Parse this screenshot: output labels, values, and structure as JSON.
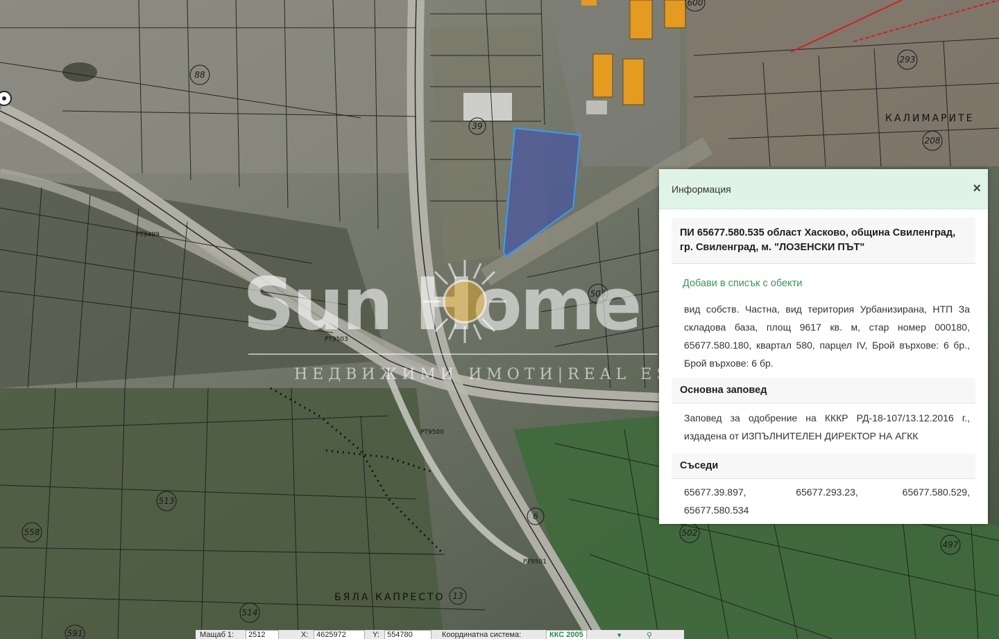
{
  "map": {
    "parcel_labels": [
      "88",
      "39",
      "293",
      "208",
      "503",
      "513",
      "558",
      "514",
      "502",
      "497",
      "591",
      "600",
      "13",
      "6"
    ],
    "place_labels": [
      "КАЛИМАРИТЕ",
      "БЯЛА КАПРЕСТО"
    ],
    "point_labels": [
      "PT9499",
      "PT9503",
      "PT9500",
      "PT9501"
    ],
    "selected_parcel_color": "#3a4ab3",
    "watermark": {
      "brand": "Sun Home",
      "tagline": "НЕДВИЖИМИ ИМОТИ|REAL ESTATE"
    }
  },
  "panel": {
    "title": "Информация",
    "close_glyph": "×",
    "pi_title": "ПИ 65677.580.535 област Хасково, община Свиленград, гр. Свиленград, м. \"ЛОЗЕНСКИ ПЪТ\"",
    "add_link": "Добави в списък с обекти",
    "details": "вид собств. Частна, вид територия Урбанизирана, НТП За складова база, площ 9617 кв. м, стар номер 000180, 65677.580.180, квартал 580, парцел IV, Брой върхове: 6 бр., Брой върхове: 6 бр.",
    "order_heading": "Основна заповед",
    "order_text": "Заповед за одобрение на КККР РД-18-107/13.12.2016 г., издадена от ИЗПЪЛНИТЕЛЕН ДИРЕКТОР НА АГКК",
    "neighbors_heading": "Съседи",
    "neighbors": [
      "65677.39.897,",
      "65677.293.23,",
      "65677.580.529,",
      "65677.580.534"
    ]
  },
  "statusbar": {
    "scale_label": "Мащаб 1:",
    "scale_value": "2512",
    "x_label": "X:",
    "x_value": "4625972",
    "y_label": "Y:",
    "y_value": "554780",
    "crs_label": "Координатна система:",
    "crs_value": "ККС 2005"
  }
}
